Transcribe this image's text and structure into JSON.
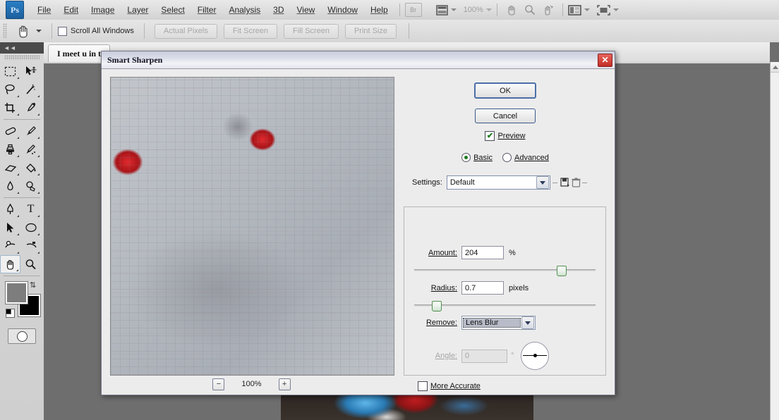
{
  "app": {
    "logo": "Ps",
    "menus": [
      "File",
      "Edit",
      "Image",
      "Layer",
      "Select",
      "Filter",
      "Analysis",
      "3D",
      "View",
      "Window",
      "Help"
    ],
    "bridge_label": "Br",
    "zoom_level": "100%",
    "icons": {
      "bridge": "bridge-icon",
      "view_extras": "view-extras-icon",
      "hand": "hand-icon",
      "zoom": "zoom-icon",
      "rotate_view": "rotate-view-icon",
      "arrange_documents": "arrange-documents-icon",
      "screen_mode": "screen-mode-icon"
    }
  },
  "options_bar": {
    "tool_icon": "hand-tool-icon",
    "scroll_all_windows": "Scroll All Windows",
    "scroll_all_checked": false,
    "buttons": [
      "Actual Pixels",
      "Fit Screen",
      "Fill Screen",
      "Print Size"
    ]
  },
  "toolbar": {
    "collapse_label": "◄◄",
    "tools": [
      {
        "name": "rectangular-marquee-tool",
        "glyph": "⬚",
        "selected": false,
        "has_flyout": true
      },
      {
        "name": "move-tool",
        "glyph": "✙",
        "selected": false,
        "has_flyout": false
      },
      {
        "name": "lasso-tool",
        "glyph": "❀",
        "selected": false,
        "has_flyout": true
      },
      {
        "name": "magic-wand-tool",
        "glyph": "✳",
        "selected": false,
        "has_flyout": true
      },
      {
        "name": "crop-tool",
        "glyph": "⌧",
        "selected": false,
        "has_flyout": true
      },
      {
        "name": "eyedropper-tool",
        "glyph": "✒",
        "selected": false,
        "has_flyout": true
      },
      {
        "name": "healing-brush-tool",
        "glyph": "▭",
        "selected": false,
        "has_flyout": true
      },
      {
        "name": "brush-tool",
        "glyph": "✐",
        "selected": false,
        "has_flyout": true
      },
      {
        "name": "clone-stamp-tool",
        "glyph": "⚑",
        "selected": false,
        "has_flyout": true
      },
      {
        "name": "history-brush-tool",
        "glyph": "✑",
        "selected": false,
        "has_flyout": true
      },
      {
        "name": "eraser-tool",
        "glyph": "▱",
        "selected": false,
        "has_flyout": true
      },
      {
        "name": "gradient-tool",
        "glyph": "◧",
        "selected": false,
        "has_flyout": true
      },
      {
        "name": "blur-tool",
        "glyph": "●",
        "selected": false,
        "has_flyout": true
      },
      {
        "name": "dodge-tool",
        "glyph": "◔",
        "selected": false,
        "has_flyout": true
      },
      {
        "name": "pen-tool",
        "glyph": "✑",
        "selected": false,
        "has_flyout": true
      },
      {
        "name": "type-tool",
        "glyph": "T",
        "selected": false,
        "has_flyout": true
      },
      {
        "name": "path-selection-tool",
        "glyph": "➤",
        "selected": false,
        "has_flyout": true
      },
      {
        "name": "ellipse-shape-tool",
        "glyph": "⬭",
        "selected": false,
        "has_flyout": true
      },
      {
        "name": "rotate-view-tool",
        "glyph": "↻",
        "selected": false,
        "has_flyout": true
      },
      {
        "name": "3d-orbit-tool",
        "glyph": "↺",
        "selected": false,
        "has_flyout": true
      },
      {
        "name": "hand-tool",
        "glyph": "✋",
        "selected": true,
        "has_flyout": true
      },
      {
        "name": "zoom-tool",
        "glyph": "⚲",
        "selected": false,
        "has_flyout": false
      }
    ],
    "foreground_color": "#7d7d7d",
    "background_color": "#000000",
    "swap_icon": "swap-colors-icon",
    "default_colors_icon": "default-colors-icon",
    "quick_mask_icon": "quick-mask-icon"
  },
  "document": {
    "tab_title": "I meet u in t"
  },
  "dialog": {
    "title": "Smart Sharpen",
    "close_label": "✕",
    "ok_label": "OK",
    "cancel_label": "Cancel",
    "preview_label": "Preview",
    "preview_checked": true,
    "preview_check_glyph": "✔",
    "mode_basic": "Basic",
    "mode_advanced": "Advanced",
    "mode_selected": "Basic",
    "settings_label": "Settings:",
    "settings_value": "Default",
    "settings_save_icon": "save-preset-icon",
    "settings_delete_icon": "delete-preset-icon",
    "amount_label": "Amount:",
    "amount_value": "204",
    "amount_unit": "%",
    "amount_slider_pct": 81,
    "radius_label": "Radius:",
    "radius_value": "0.7",
    "radius_unit": "pixels",
    "radius_slider_pct": 12,
    "remove_label": "Remove:",
    "remove_value": "Lens Blur",
    "angle_label": "Angle:",
    "angle_value": "0",
    "angle_unit": "°",
    "angle_disabled": true,
    "more_accurate_label": "More Accurate",
    "more_accurate_checked": false,
    "zoom_out_label": "−",
    "zoom_in_label": "+",
    "preview_zoom": "100%"
  },
  "colors": {
    "accent": "#4b6fa8",
    "close_red": "#c22d27",
    "check_green": "#1a7a1a",
    "canvas_bg": "#6e6e6e"
  }
}
